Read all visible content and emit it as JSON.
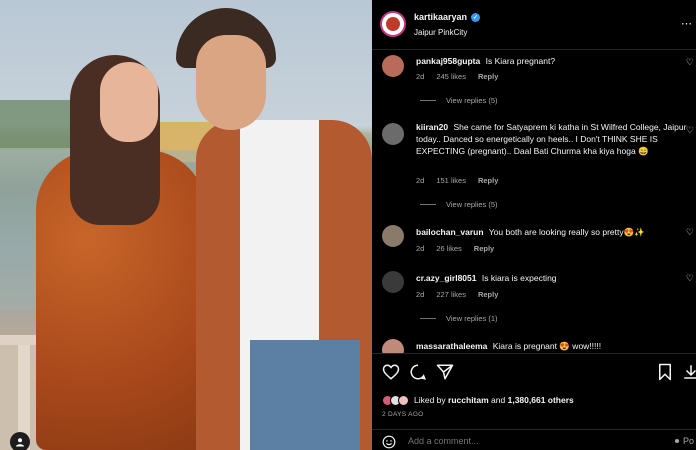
{
  "post": {
    "username": "kartikaaryan",
    "location": "Jaipur PinkCity",
    "more_icon": "more-horizontal-icon"
  },
  "comments": [
    {
      "username": "pankaj958gupta",
      "text": "Is Kiara pregnant?",
      "age": "2d",
      "likes": "245 likes",
      "reply_label": "Reply",
      "view_replies": "View replies (5)",
      "avatar_color": "#b86b5a"
    },
    {
      "username": "kiiran20",
      "text": "She came for Satyaprem ki katha in St Wilfred College, Jaipur today.. Danced so energetically on heels.. I Don't THINK SHE IS EXPECTING (pregnant).. Daal Bati Churma kha kiya hoga 😄",
      "age": "2d",
      "likes": "151 likes",
      "reply_label": "Reply",
      "view_replies": "View replies (5)",
      "avatar_color": "#6b6b6b"
    },
    {
      "username": "bailochan_varun",
      "text": "You both are looking really so pretty😍✨",
      "age": "2d",
      "likes": "26 likes",
      "reply_label": "Reply",
      "avatar_color": "#8a7a6a"
    },
    {
      "username": "cr.azy_girl8051",
      "text": "Is kiara is expecting",
      "age": "2d",
      "likes": "227 likes",
      "reply_label": "Reply",
      "view_replies": "View replies (1)",
      "avatar_color": "#3a3a3a"
    },
    {
      "username": "massarathaleema",
      "text": "Kiara is pregnant 😍 wow!!!!!",
      "avatar_color": "#c08a7a"
    }
  ],
  "actions": {
    "liked_by_prefix": "Liked by",
    "liked_by_user": "rucchitam",
    "liked_by_joiner": "and",
    "likes_count": "1,380,661 others",
    "time_ago": "2 DAYS AGO",
    "mini_avatar_colors": [
      "#d65a7a",
      "#e0e0e0",
      "#f0c0c0"
    ]
  },
  "composer": {
    "placeholder": "Add a comment...",
    "post_label": "Po"
  }
}
